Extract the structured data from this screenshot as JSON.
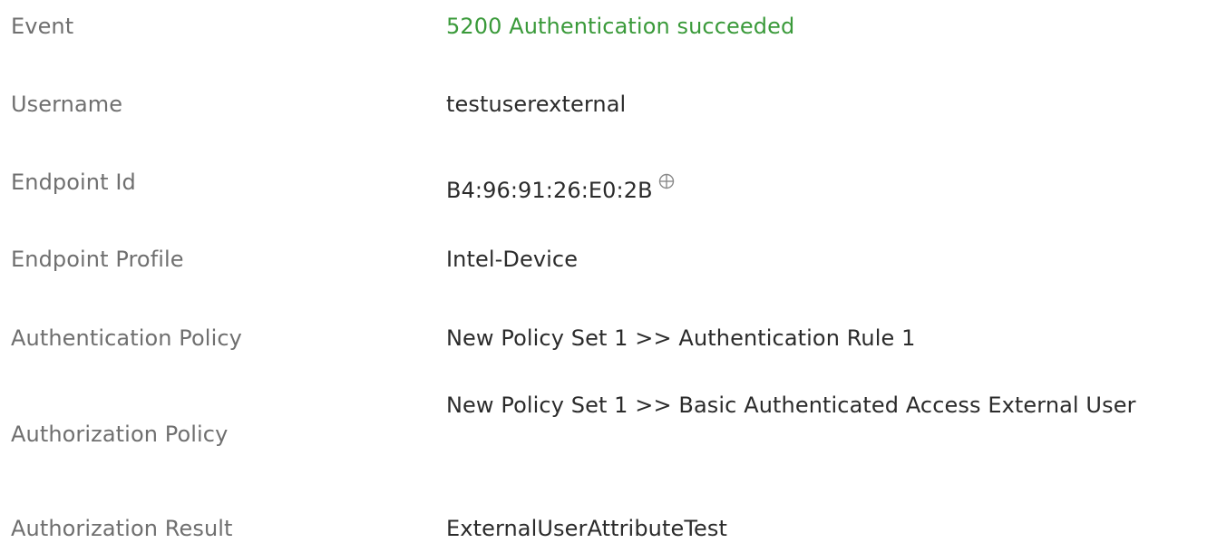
{
  "details": {
    "rows": [
      {
        "label": "Event",
        "value": "5200 Authentication succeeded",
        "value_color": "#3a9a3a"
      },
      {
        "label": "Username",
        "value": "testuserexternal"
      },
      {
        "label": "Endpoint Id",
        "value": "B4:96:91:26:E0:2B",
        "icon": "crosshair-icon"
      },
      {
        "label": "Endpoint Profile",
        "value": "Intel-Device"
      },
      {
        "label": "Authentication Policy",
        "value": "New Policy Set 1 >> Authentication Rule 1"
      },
      {
        "label": "Authorization Policy",
        "value": "New Policy Set 1 >> Basic Authenticated Access External User"
      },
      {
        "label": "Authorization Result",
        "value": "ExternalUserAttributeTest"
      }
    ]
  },
  "colors": {
    "label": "#6f6f6f",
    "value": "#2b2b2b",
    "success": "#3a9a3a",
    "icon": "#8a8a8a"
  }
}
